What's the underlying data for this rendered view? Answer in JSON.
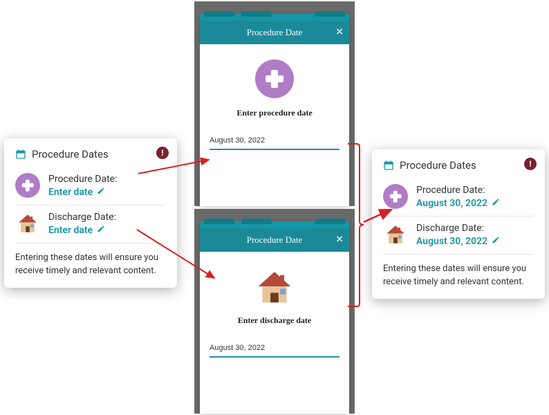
{
  "card_title": "Procedure Dates",
  "left": {
    "procedure": {
      "label": "Procedure Date:",
      "value": "Enter date"
    },
    "discharge": {
      "label": "Discharge Date:",
      "value": "Enter date"
    }
  },
  "right": {
    "procedure": {
      "label": "Procedure Date:",
      "value": "August 30, 2022"
    },
    "discharge": {
      "label": "Discharge Date:",
      "value": "August 30, 2022"
    }
  },
  "helper": "Entering these dates will ensure you receive timely and relevant content.",
  "modal": {
    "header": "Procedure Date",
    "procedure_prompt": "Enter procedure date",
    "discharge_prompt": "Enter discharge date",
    "input_value": "August 30, 2022"
  },
  "colors": {
    "accent": "#1596a6",
    "alert": "#7a212c",
    "plus": "#b07cc6"
  }
}
